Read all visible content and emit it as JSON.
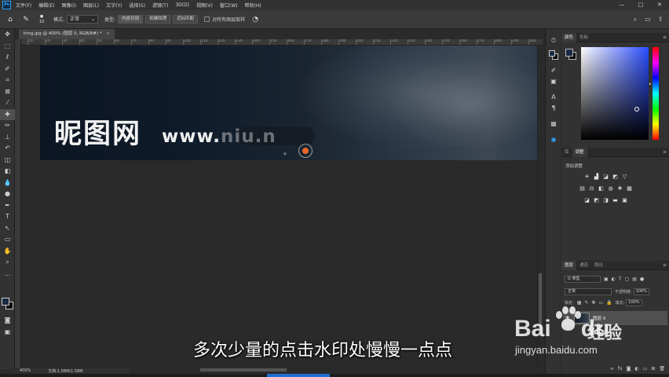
{
  "app": {
    "logo": "Ps"
  },
  "menu": [
    "文件(F)",
    "编辑(E)",
    "图像(I)",
    "图层(L)",
    "文字(Y)",
    "选择(S)",
    "滤镜(T)",
    "3D(D)",
    "视图(V)",
    "窗口(W)",
    "帮助(H)"
  ],
  "window_controls": {
    "minimize": "—",
    "maximize": "□",
    "close": "✕"
  },
  "options": {
    "brush_size": "10",
    "mode_label": "模式:",
    "mode_value": "正常",
    "type_label": "类型:",
    "type_buttons": [
      "内容识别",
      "创建纹理",
      "近似匹配"
    ],
    "sample_all_label": "对所有图层取样"
  },
  "document": {
    "tab_title": "timg.jpg @ 400% (图层 0, RGB/8#) *",
    "tab_close": "×"
  },
  "ruler": {
    "ticks": [
      "10",
      "20",
      "30",
      "40",
      "50",
      "60",
      "70",
      "80",
      "90",
      "100",
      "110",
      "120",
      "130",
      "140",
      "150",
      "160",
      "170",
      "180",
      "190",
      "200",
      "210",
      "220",
      "230",
      "240",
      "250",
      "260",
      "270",
      "280",
      "290",
      "300"
    ]
  },
  "canvas": {
    "watermark_main": "昵图网",
    "watermark_url_visible": "www.",
    "watermark_url_faded": "niu.n"
  },
  "status": {
    "zoom": "400%",
    "doc_size": "文档:1.58M/1.58M"
  },
  "panels": {
    "color_tabs": [
      "颜色",
      "色板"
    ],
    "adjust_tabs": [
      "库",
      "调整"
    ],
    "adjust_title": "添加调整",
    "layers_tabs": [
      "图层",
      "通道",
      "路径"
    ],
    "layers_filter": "Q 类型",
    "blend_mode": "正常",
    "opacity_label": "不透明度:",
    "opacity_value": "100%",
    "lock_label": "锁定:",
    "fill_label": "填充:",
    "fill_value": "100%",
    "layer_name": "图层 0"
  },
  "overlay": {
    "subtitle": "多次少量的点击水印处慢慢一点点",
    "baidu_text": "Bai",
    "baidu_du": "du",
    "jingyan_cn": "经验",
    "jingyan_url": "jingyan.baidu.com"
  },
  "colors": {
    "foreground": "#1b2a44",
    "background": "#000000",
    "brush_accent": "#e8692a",
    "ps_blue": "#31a8ff"
  }
}
